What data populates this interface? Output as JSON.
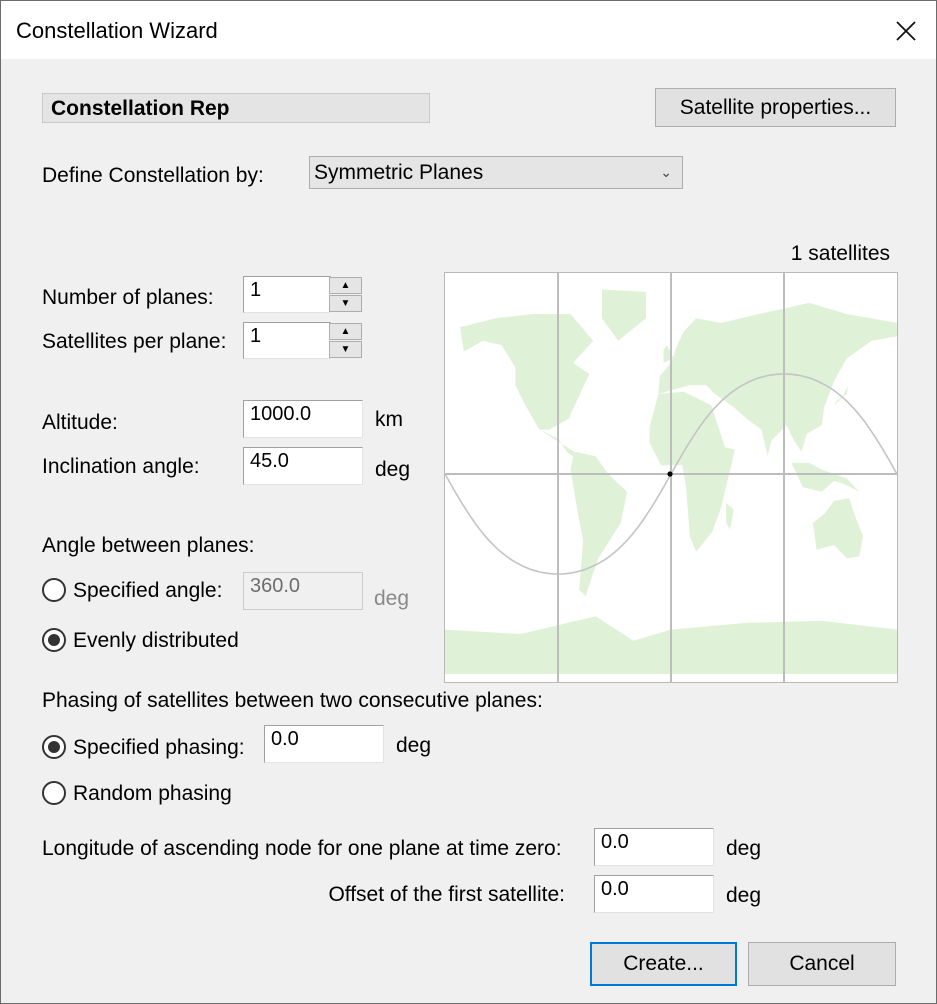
{
  "window": {
    "title": "Constellation Wizard",
    "close_icon": "close-icon"
  },
  "header": {
    "name_value": "Constellation Rep",
    "satellite_properties_label": "Satellite properties..."
  },
  "define": {
    "label": "Define Constellation by:",
    "selected": "Symmetric Planes"
  },
  "planes": {
    "number_label": "Number of planes:",
    "number_value": "1",
    "per_plane_label": "Satellites per plane:",
    "per_plane_value": "1"
  },
  "orbit": {
    "altitude_label": "Altitude:",
    "altitude_value": "1000.0",
    "altitude_unit": "km",
    "inclination_label": "Inclination angle:",
    "inclination_value": "45.0",
    "inclination_unit": "deg"
  },
  "angle_between": {
    "heading": "Angle between planes:",
    "specified_label": "Specified angle:",
    "specified_value": "360.0",
    "specified_unit": "deg",
    "specified_checked": false,
    "evenly_label": "Evenly distributed",
    "evenly_checked": true
  },
  "phasing": {
    "heading": "Phasing of satellites between two consecutive planes:",
    "specified_label": "Specified phasing:",
    "specified_value": "0.0",
    "specified_unit": "deg",
    "specified_checked": true,
    "random_label": "Random phasing",
    "random_checked": false
  },
  "node": {
    "longitude_label": "Longitude of ascending node for one plane at time zero:",
    "longitude_value": "0.0",
    "longitude_unit": "deg",
    "offset_label": "Offset of the first satellite:",
    "offset_value": "0.0",
    "offset_unit": "deg"
  },
  "preview": {
    "count_label": "1 satellites",
    "inclination_deg": 45,
    "satellite_lon_deg": 0,
    "satellite_lat_deg": 0,
    "land_color": "#dff2d8",
    "grid_color": "#bdbdbd",
    "track_color": "#c4c4c4"
  },
  "footer": {
    "create_label": "Create...",
    "cancel_label": "Cancel"
  }
}
